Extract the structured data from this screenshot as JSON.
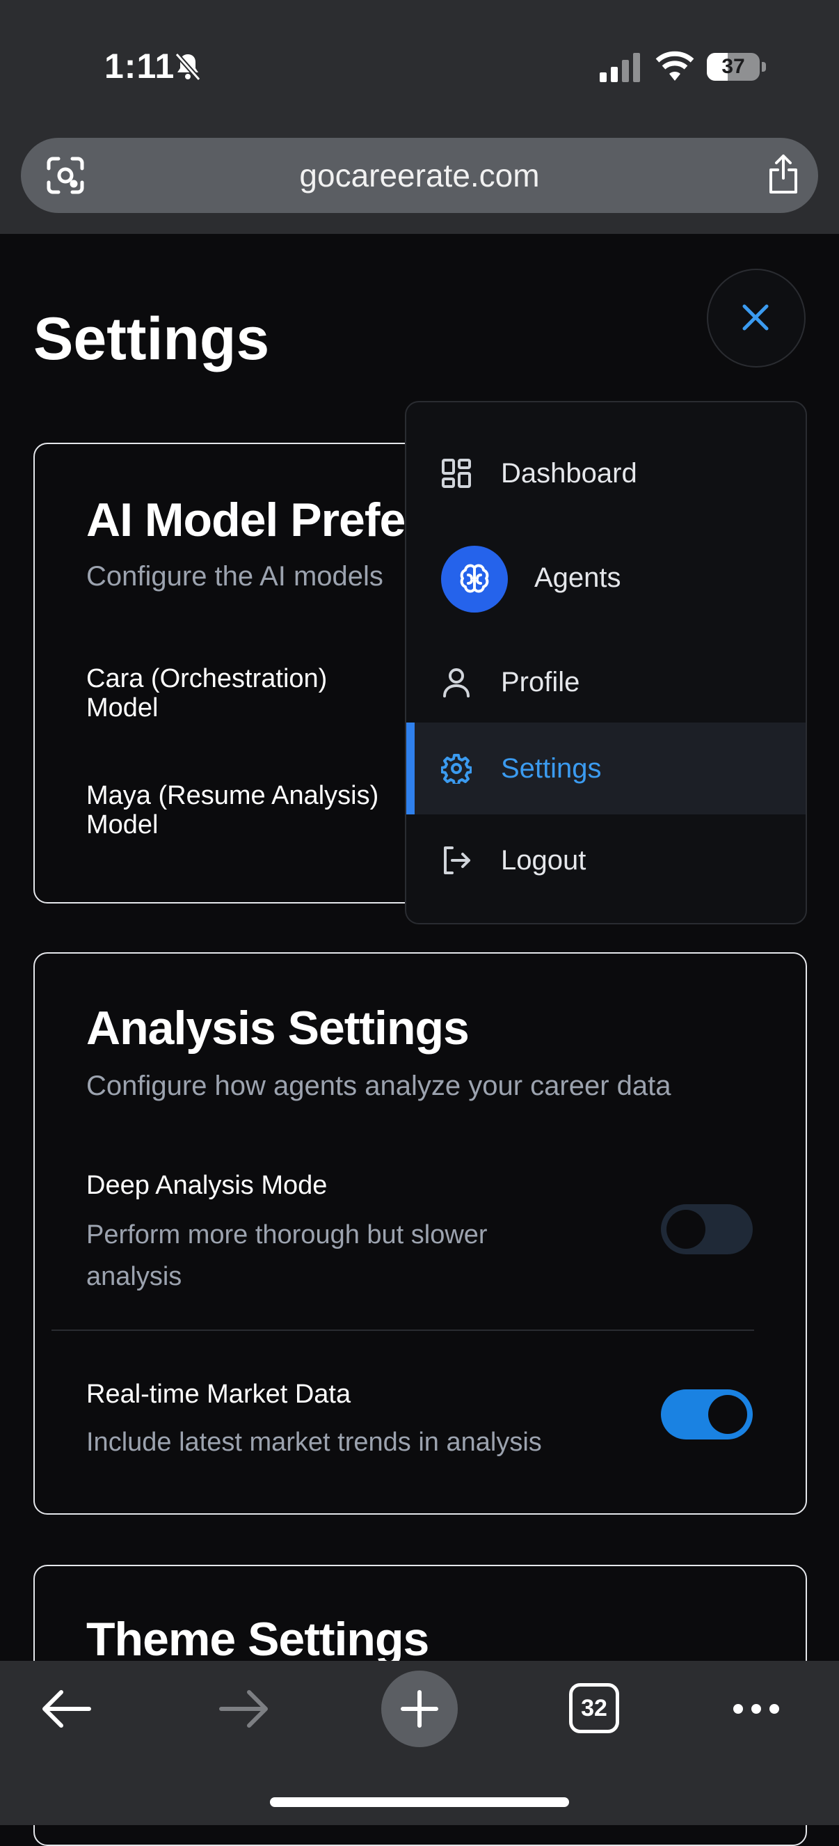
{
  "status_bar": {
    "time": "1:11",
    "battery": "37"
  },
  "browser": {
    "url": "gocareerate.com",
    "tab_count": "32"
  },
  "page": {
    "title": "Settings"
  },
  "ai_model_card": {
    "title": "AI Model Preferences",
    "subtitle": "Configure the AI models",
    "rows": [
      {
        "label": "Cara (Orchestration) Model"
      },
      {
        "label": "Maya (Resume Analysis) Model"
      }
    ]
  },
  "analysis_card": {
    "title": "Analysis Settings",
    "subtitle": "Configure how agents analyze your career data",
    "settings": [
      {
        "label": "Deep Analysis Mode",
        "description": "Perform more thorough but slower analysis",
        "enabled": false
      },
      {
        "label": "Real-time Market Data",
        "description": "Include latest market trends in analysis",
        "enabled": true
      }
    ]
  },
  "theme_card": {
    "title": "Theme Settings"
  },
  "menu": {
    "items": [
      {
        "label": "Dashboard",
        "icon": "grid-icon"
      },
      {
        "label": "Agents",
        "icon": "brain-icon"
      },
      {
        "label": "Profile",
        "icon": "user-icon"
      },
      {
        "label": "Settings",
        "icon": "gear-icon",
        "active": true
      },
      {
        "label": "Logout",
        "icon": "logout-icon"
      }
    ]
  },
  "colors": {
    "accent": "#2f80ed",
    "agents_badge": "#2563eb",
    "toggle_on": "#1a82e2",
    "background": "#0b0b0d"
  }
}
